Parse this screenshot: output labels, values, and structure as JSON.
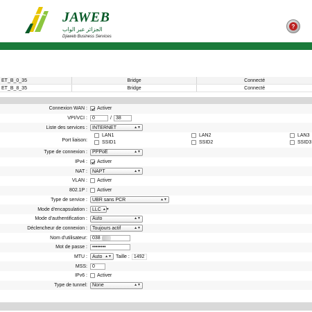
{
  "brand": {
    "name": "JAWEB",
    "arabic": "الجزائر عبر الواب",
    "tagline": "Djaweb Business Services"
  },
  "connections": [
    {
      "name": "ET_B_0_35",
      "mode": "Bridge",
      "status": "Connecté"
    },
    {
      "name": "ET_B_8_35",
      "mode": "Bridge",
      "status": "Connecté"
    }
  ],
  "form": {
    "wan": {
      "label": "Connexion WAN :",
      "option": "Activer",
      "checked": true
    },
    "vpi": {
      "label": "VPI/VCI :",
      "vpi": "0",
      "sep": "/",
      "vci": "38"
    },
    "services": {
      "label": "Liste des services :",
      "value": "INTERNET"
    },
    "port": {
      "label": "Port liaison:",
      "items": [
        {
          "name": "LAN1",
          "checked": false
        },
        {
          "name": "LAN2",
          "checked": false
        },
        {
          "name": "LAN3",
          "checked": false
        },
        {
          "name": "SSID1",
          "checked": false
        },
        {
          "name": "SSID2",
          "checked": false
        },
        {
          "name": "SSID3",
          "checked": false
        }
      ]
    },
    "conn_type": {
      "label": "Type de connexion :",
      "value": "PPPoE"
    },
    "ipv4": {
      "label": "IPv4 :",
      "option": "Activer",
      "checked": true
    },
    "nat": {
      "label": "NAT :",
      "value": "NAPT"
    },
    "vlan": {
      "label": "VLAN :",
      "option": "Activer",
      "checked": false
    },
    "p8021": {
      "label": "802.1P :",
      "option": "Activer",
      "checked": false
    },
    "service_type": {
      "label": "Type de service :",
      "value": "UBR sans PCR"
    },
    "encap": {
      "label": "Mode d'encapsulation :",
      "value": "LLC"
    },
    "auth": {
      "label": "Mode d'authentification :",
      "value": "Auto"
    },
    "trigger": {
      "label": "Déclencheur de connexion :",
      "value": "Toujours actif"
    },
    "username": {
      "label": "Nom d'utilisateur:",
      "value": "038"
    },
    "password": {
      "label": "Mot de passe :",
      "value": "••••••••"
    },
    "mtu": {
      "label": "MTU :",
      "value": "Auto",
      "size_label": "Taille :",
      "size": "1492"
    },
    "mss": {
      "label": "MSS:",
      "value": "0"
    },
    "ipv6": {
      "label": "IPv6 :",
      "option": "Activer",
      "checked": false
    },
    "tunnel": {
      "label": "Type de tunnel:",
      "value": "None"
    }
  },
  "colors": {
    "brand_green": "#0a5b2a",
    "bar_green": "#1a7a3a"
  },
  "icons": {
    "help": "help-icon",
    "logo": "jaweb-logo-icon"
  }
}
